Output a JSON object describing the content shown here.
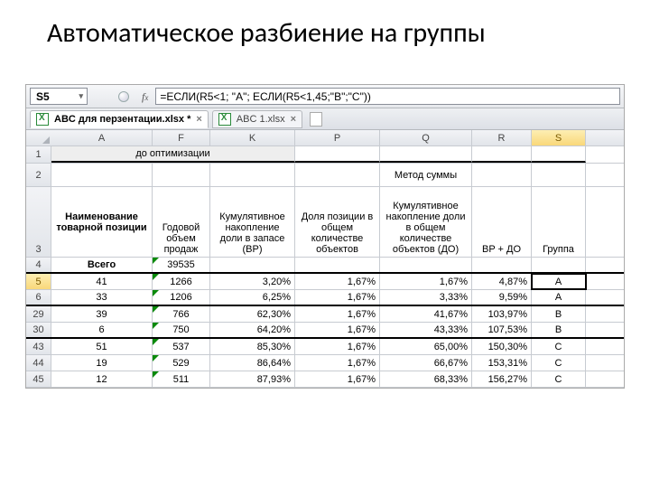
{
  "slide": {
    "title": "Автоматическое разбиение на группы"
  },
  "namebox": {
    "cell": "S5"
  },
  "formula_bar": {
    "value": "=ЕСЛИ(R5<1; \"A\"; ЕСЛИ(R5<1,45;\"B\";\"C\"))"
  },
  "workbook_tabs": [
    {
      "label": "ABC для перзентации.xlsx *",
      "active": true
    },
    {
      "label": "ABC 1.xlsx",
      "active": false
    }
  ],
  "columns": [
    "A",
    "F",
    "K",
    "P",
    "Q",
    "R",
    "S"
  ],
  "row1": {
    "merged_label": "до оптимизации"
  },
  "row2": {
    "method_label": "Метод суммы"
  },
  "row3_headers": {
    "A": "Наименование товарной позиции",
    "F": "Годовой объем продаж",
    "K": "Кумулятивное накопление доли в запасе (BP)",
    "P": "Доля позиции в общем количестве объектов",
    "Q": "Кумулятивное накопление доли в общем количестве объектов (ДО)",
    "R": "BP + ДО",
    "S": "Группа"
  },
  "row4": {
    "A": "Всего",
    "F": "39535"
  },
  "data_rows": [
    {
      "n": "5",
      "A": "41",
      "F": "1266",
      "K": "3,20%",
      "P": "1,67%",
      "Q": "1,67%",
      "R": "4,87%",
      "S": "A"
    },
    {
      "n": "6",
      "A": "33",
      "F": "1206",
      "K": "6,25%",
      "P": "1,67%",
      "Q": "3,33%",
      "R": "9,59%",
      "S": "A"
    },
    {
      "n": "29",
      "A": "39",
      "F": "766",
      "K": "62,30%",
      "P": "1,67%",
      "Q": "41,67%",
      "R": "103,97%",
      "S": "B"
    },
    {
      "n": "30",
      "A": "6",
      "F": "750",
      "K": "64,20%",
      "P": "1,67%",
      "Q": "43,33%",
      "R": "107,53%",
      "S": "B"
    },
    {
      "n": "43",
      "A": "51",
      "F": "537",
      "K": "85,30%",
      "P": "1,67%",
      "Q": "65,00%",
      "R": "150,30%",
      "S": "C"
    },
    {
      "n": "44",
      "A": "19",
      "F": "529",
      "K": "86,64%",
      "P": "1,67%",
      "Q": "66,67%",
      "R": "153,31%",
      "S": "C"
    },
    {
      "n": "45",
      "A": "12",
      "F": "511",
      "K": "87,93%",
      "P": "1,67%",
      "Q": "68,33%",
      "R": "156,27%",
      "S": "C"
    }
  ]
}
